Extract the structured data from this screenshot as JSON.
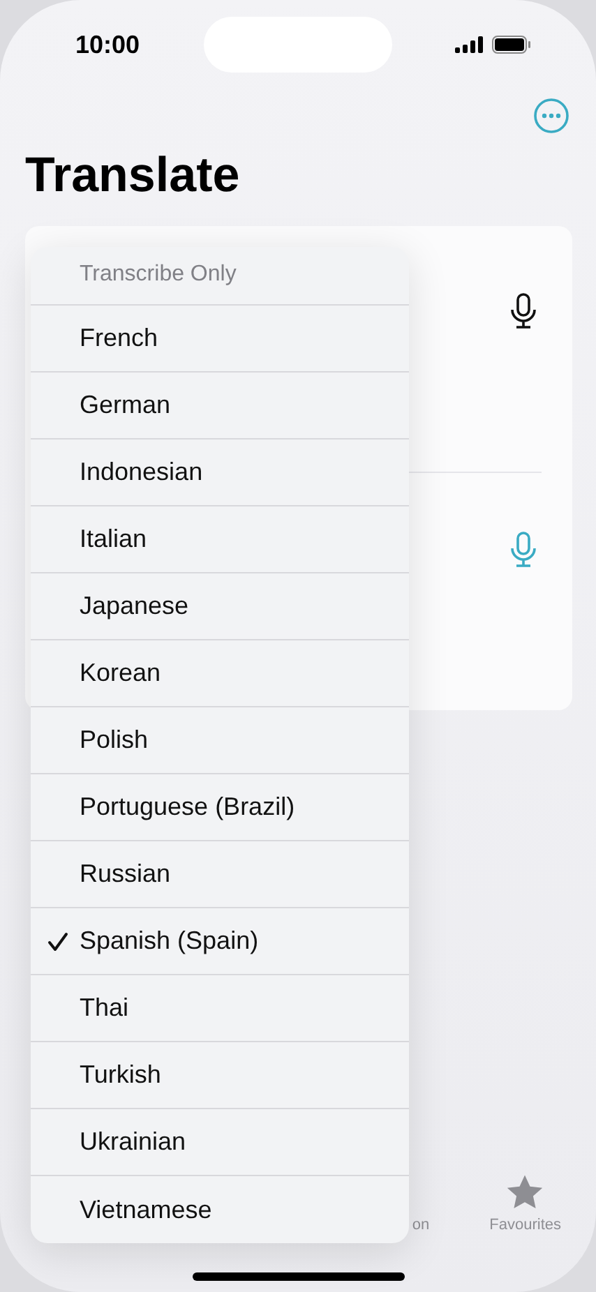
{
  "status_bar": {
    "time": "10:00"
  },
  "title": "Translate",
  "menu": {
    "subtitle": "Transcribe Only",
    "items": [
      {
        "label": "French",
        "selected": false
      },
      {
        "label": "German",
        "selected": false
      },
      {
        "label": "Indonesian",
        "selected": false
      },
      {
        "label": "Italian",
        "selected": false
      },
      {
        "label": "Japanese",
        "selected": false
      },
      {
        "label": "Korean",
        "selected": false
      },
      {
        "label": "Polish",
        "selected": false
      },
      {
        "label": "Portuguese (Brazil)",
        "selected": false
      },
      {
        "label": "Russian",
        "selected": false
      },
      {
        "label": "Spanish (Spain)",
        "selected": true
      },
      {
        "label": "Thai",
        "selected": false
      },
      {
        "label": "Turkish",
        "selected": false
      },
      {
        "label": "Ukrainian",
        "selected": false
      },
      {
        "label": "Vietnamese",
        "selected": false
      }
    ]
  },
  "tab_bar": [
    {
      "label": "on",
      "kind": "partial"
    },
    {
      "label": "Favourites",
      "kind": "star"
    }
  ]
}
